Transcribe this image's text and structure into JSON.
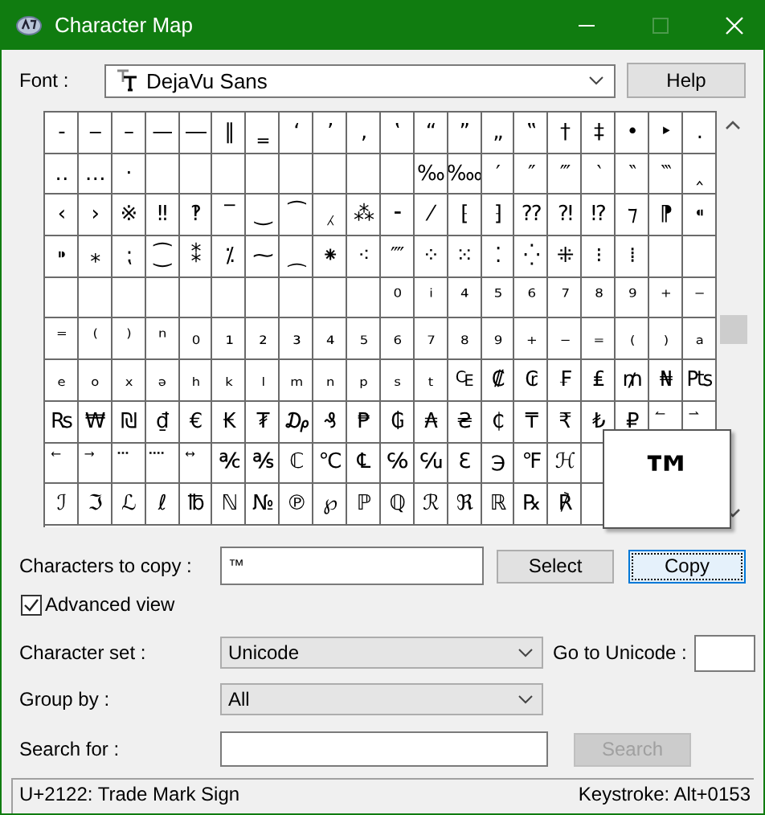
{
  "window": {
    "title": "Character Map"
  },
  "font": {
    "label": "Font :",
    "value": "DejaVu Sans"
  },
  "help_button": "Help",
  "grid": {
    "rows": [
      [
        "‐",
        "‒",
        "–",
        "—",
        "―",
        "‖",
        "‗",
        "‘",
        "’",
        "‚",
        "‛",
        "“",
        "”",
        "„",
        "‟",
        "†",
        "‡",
        "•",
        "‣",
        "․"
      ],
      [
        "‥",
        "…",
        "‧",
        null,
        null,
        null,
        null,
        null,
        null,
        null,
        null,
        "‰",
        "‱",
        "′",
        "″",
        "‴",
        "‵",
        "‶",
        "‷",
        "‸"
      ],
      [
        "‹",
        "›",
        "※",
        "‼",
        "‽",
        "‾",
        "‿",
        "⁀",
        "⁁",
        "⁂",
        "⁃",
        "⁄",
        "⁅",
        "⁆",
        "⁇",
        "⁈",
        "⁉",
        "⁊",
        "⁋",
        "⁌"
      ],
      [
        "⁍",
        "⁎",
        "⁏",
        "⁐",
        "⁑",
        "⁒",
        "⁓",
        "⁔",
        "⁕",
        "⁖",
        "⁗",
        "⁘",
        "⁙",
        "⁚",
        "⁛",
        "⁜",
        "⁝",
        "⁞",
        null,
        null
      ],
      [
        null,
        null,
        null,
        null,
        null,
        null,
        null,
        null,
        null,
        null,
        "⁰",
        "ⁱ",
        "⁴",
        "⁵",
        "⁶",
        "⁷",
        "⁸",
        "⁹",
        "⁺",
        "⁻"
      ],
      [
        "⁼",
        "⁽",
        "⁾",
        "ⁿ",
        "₀",
        "₁",
        "₂",
        "₃",
        "₄",
        "₅",
        "₆",
        "₇",
        "₈",
        "₉",
        "₊",
        "₋",
        "₌",
        "₍",
        "₎",
        "ₐ"
      ],
      [
        "ₑ",
        "ₒ",
        "ₓ",
        "ₔ",
        "ₕ",
        "ₖ",
        "ₗ",
        "ₘ",
        "ₙ",
        "ₚ",
        "ₛ",
        "ₜ",
        "₠",
        "₡",
        "₢",
        "₣",
        "₤",
        "₥",
        "₦",
        "₧"
      ],
      [
        "₨",
        "₩",
        "₪",
        "₫",
        "€",
        "₭",
        "₮",
        "₯",
        "₰",
        "₱",
        "₲",
        "₳",
        "₴",
        "₵",
        "₸",
        "₹",
        "₺",
        "₽",
        "⃐",
        "⃑"
      ],
      [
        "⃖",
        "⃗",
        "⃛",
        "⃜",
        "⃡",
        "℀",
        "℁",
        "ℂ",
        "℃",
        "℄",
        "℅",
        "℆",
        "ℇ",
        "℈",
        "℉",
        "ℋ",
        null,
        null,
        null,
        null
      ],
      [
        "ℐ",
        "ℑ",
        "ℒ",
        "ℓ",
        "℔",
        "ℕ",
        "№",
        "℗",
        "℘",
        "ℙ",
        "ℚ",
        "ℛ",
        "ℜ",
        "ℝ",
        "℞",
        "℟",
        null,
        null,
        null,
        null
      ]
    ]
  },
  "magnifier": "™",
  "copy_field": {
    "label": "Characters to copy :",
    "value": "™"
  },
  "select_button": {
    "label": "Select",
    "focused": false
  },
  "copy_button": {
    "label": "Copy",
    "focused": true
  },
  "advanced_view": {
    "label": "Advanced view",
    "checked": true
  },
  "character_set": {
    "label": "Character set :",
    "value": "Unicode"
  },
  "go_to_unicode": {
    "label": "Go to Unicode :"
  },
  "group_by": {
    "label": "Group by :",
    "value": "All"
  },
  "search": {
    "label": "Search for :",
    "button": "Search",
    "button_disabled": true
  },
  "status_bar": {
    "description": "U+2122: Trade Mark Sign",
    "keystroke": "Keystroke: Alt+0153"
  }
}
